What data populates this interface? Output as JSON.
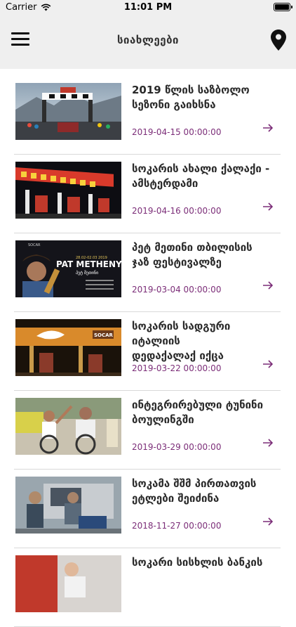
{
  "status_bar": {
    "carrier": "Carrier",
    "time": "11:01 PM"
  },
  "header": {
    "title": "სიახლეები",
    "menu_icon": "hamburger-menu-icon",
    "location_icon": "location-pin-icon"
  },
  "colors": {
    "accent": "#7b2d78",
    "nav_background": "#efefef",
    "divider": "#d9d9d9"
  },
  "news": [
    {
      "title_line1": "2019 წლის საზბოლო",
      "title_line2": "სეზონი გაიხსნა",
      "date": "2019-04-15 00:00:00",
      "image": "ski-resort-start-gate-photo"
    },
    {
      "title_line1": "სოკარის ახალი ქალაქი -",
      "title_line2": "ამსტერდამი",
      "date": "2019-04-16 00:00:00",
      "image": "gas-station-night-photo"
    },
    {
      "title_line1": "პეტ მეთინი თბილისის",
      "title_line2": "ჯაზ ფესტივალზე",
      "date": "2019-03-04 00:00:00",
      "image": "pat-metheny-poster",
      "poster_text": {
        "brand": "SOCAR",
        "name": "PAT METHENY",
        "subtitle": "პეტ მეთინი",
        "dates": "28.02-02.03 2019"
      }
    },
    {
      "title_line1": "სოკარის სადგური იტალიის",
      "title_line2": "დედაქალაქ იქცა",
      "date": "2019-03-22 00:00:00",
      "image": "socar-station-night-photo",
      "sign_text": "SOCAR"
    },
    {
      "title_line1": "ინტეგრირებული ტუნინი",
      "title_line2": "ბოულინგში",
      "date": "2019-03-29 00:00:00",
      "image": "wheelchair-bowling-photo"
    },
    {
      "title_line1": "სოკამა შშმ პირთათვის",
      "title_line2": "ეტლები შეიძინა",
      "date": "2018-11-27 00:00:00",
      "image": "wheelchair-car-photo"
    },
    {
      "title_line1": "სოკარი სისხლის ბანკის",
      "title_line2": "",
      "date": "",
      "image": "blood-donation-photo"
    }
  ]
}
